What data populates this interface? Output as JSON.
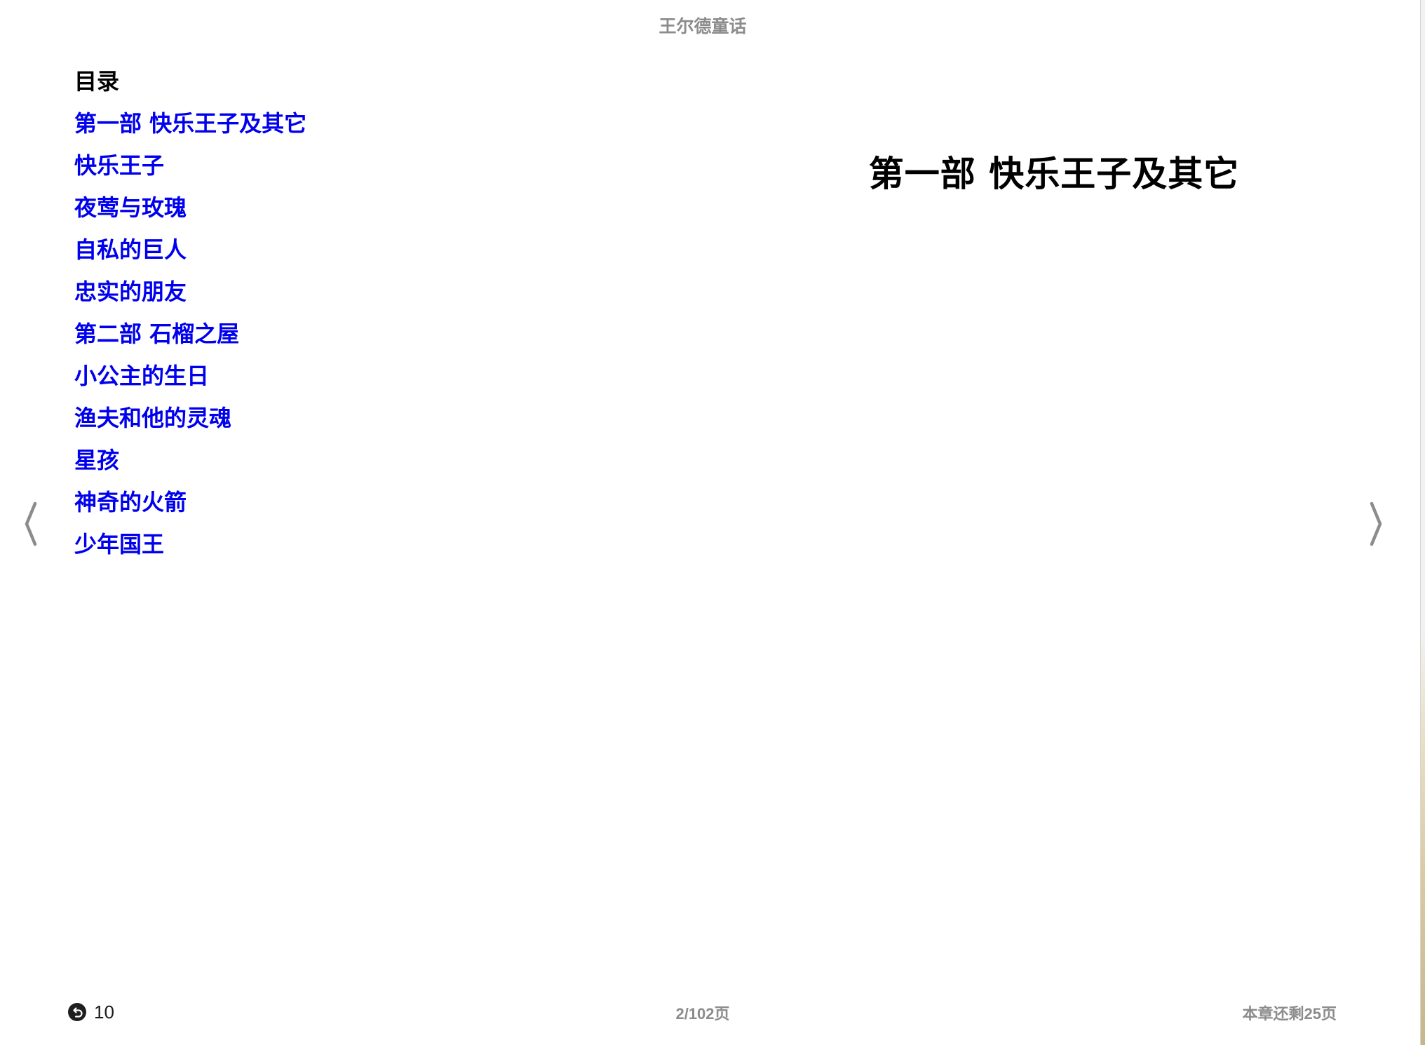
{
  "book": {
    "title": "王尔德童话"
  },
  "toc": {
    "heading": "目录",
    "items": [
      {
        "label": "第一部 快乐王子及其它"
      },
      {
        "label": "快乐王子"
      },
      {
        "label": "夜莺与玫瑰"
      },
      {
        "label": "自私的巨人"
      },
      {
        "label": "忠实的朋友"
      },
      {
        "label": "第二部 石榴之屋"
      },
      {
        "label": "小公主的生日"
      },
      {
        "label": "渔夫和他的灵魂"
      },
      {
        "label": "星孩"
      },
      {
        "label": "神奇的火箭"
      },
      {
        "label": "少年国王"
      }
    ]
  },
  "right_page": {
    "chapter_title": "第一部 快乐王子及其它"
  },
  "footer": {
    "back_count": "10",
    "page_counter": "2/102页",
    "chapter_remaining": "本章还剩25页"
  },
  "icons": {
    "prev": "chevron-left-icon",
    "next": "chevron-right-icon",
    "back": "back-arrow-icon"
  },
  "colors": {
    "link": "#0000ee",
    "muted_text": "#8c8c8c",
    "body_text": "#000000"
  }
}
